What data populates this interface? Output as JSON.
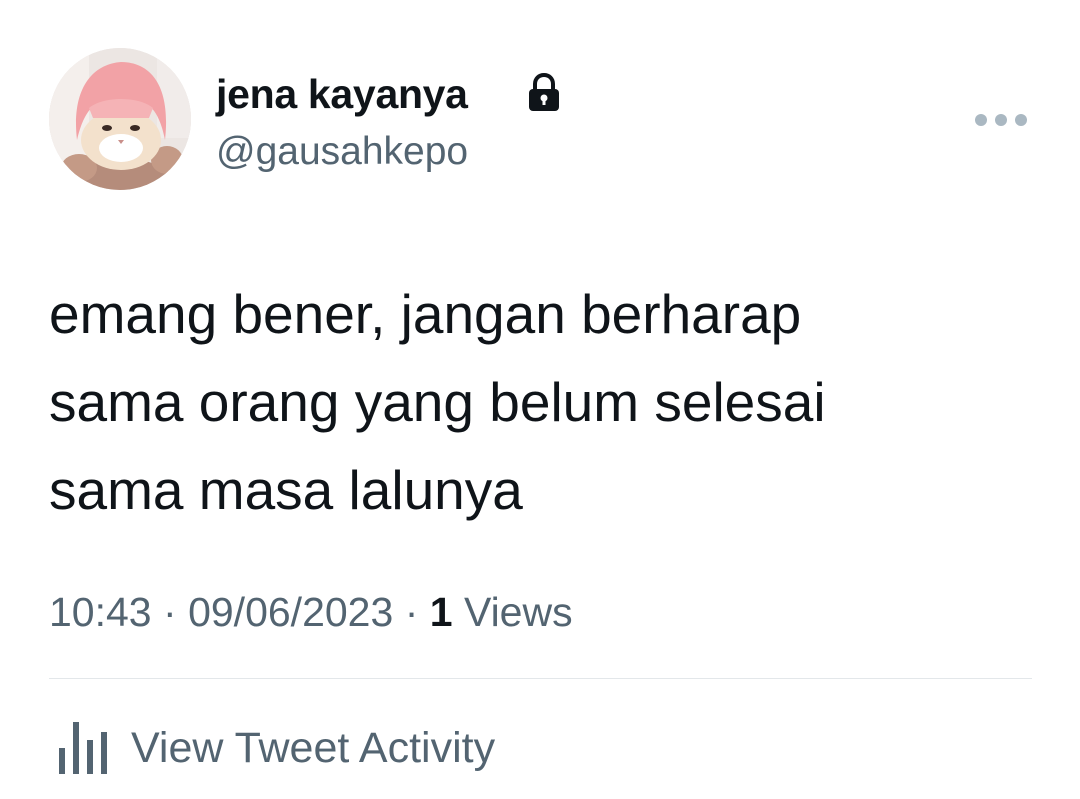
{
  "author": {
    "display_name": "jena kayanya",
    "handle": "@gausahkepo",
    "protected_icon": "lock-icon",
    "avatar": "cat-with-pink-wig-avatar"
  },
  "tweet": {
    "text_lines": [
      "emang bener, jangan berharap",
      "sama orang yang belum selesai",
      "sama masa lalunya"
    ],
    "time": "10:43",
    "separator": "·",
    "date": "09/06/2023",
    "views_count": "1",
    "views_label": "Views"
  },
  "actions": {
    "more_icon": "more-horizontal-icon",
    "activity_icon": "bar-chart-icon",
    "activity_label": "View Tweet Activity"
  },
  "colors": {
    "primary_text": "#0f1419",
    "secondary_text": "#536471",
    "divider": "#e3e7ea",
    "background": "#ffffff"
  }
}
